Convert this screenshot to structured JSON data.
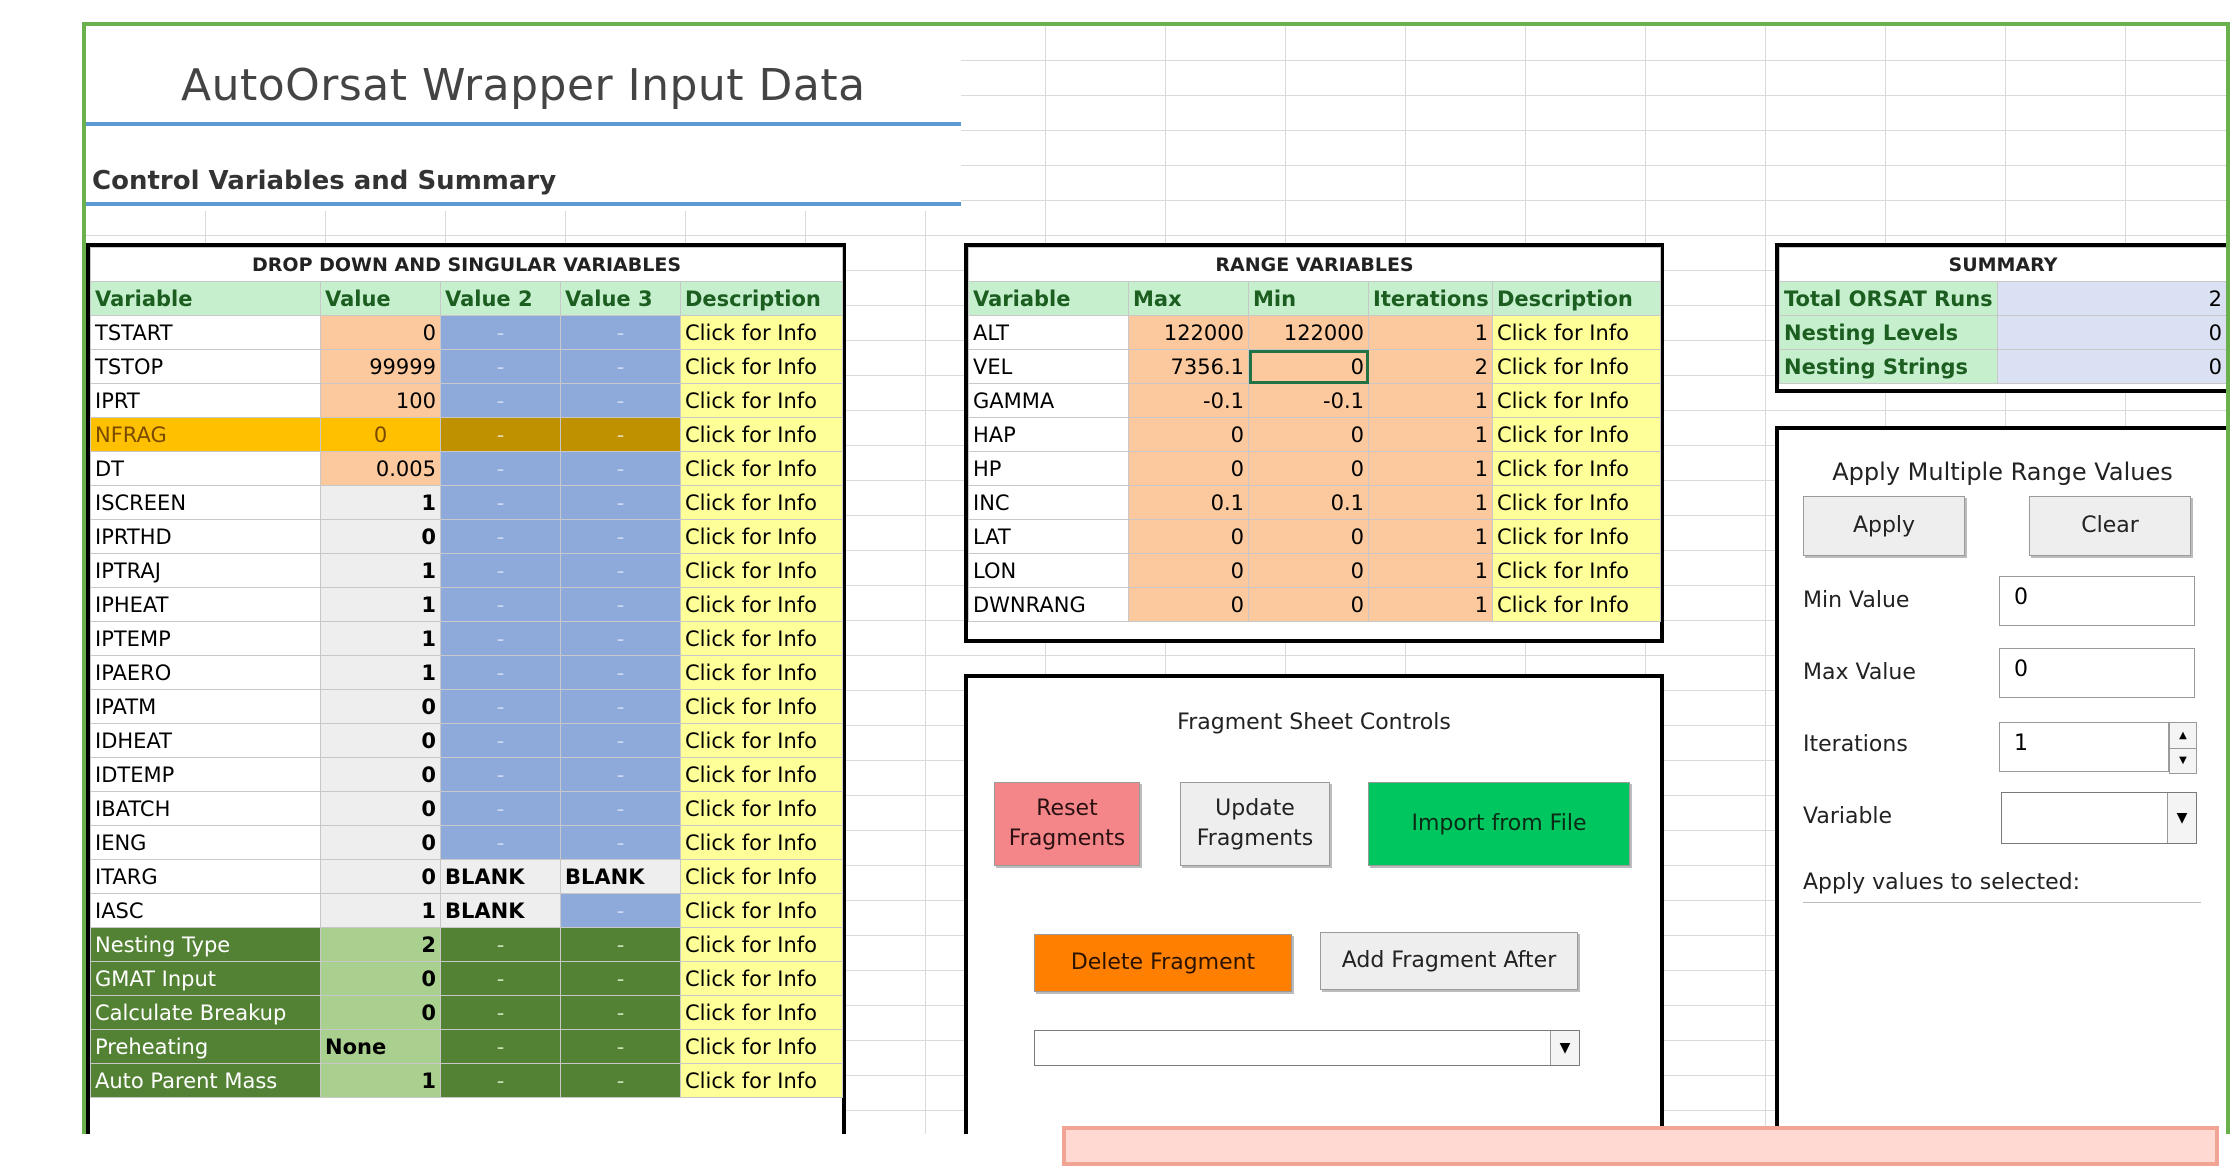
{
  "title": "AutoOrsat Wrapper Input Data",
  "subtitle": "Control Variables and Summary",
  "colors": {
    "frame_border": "#6ab04c",
    "title_rule": "#5b9bd5",
    "header_green": "#c6efce",
    "peach": "#fbc99d",
    "blue": "#8eaadb",
    "info_yellow": "#ffff99",
    "highlight": "#ffc000",
    "dark_green": "#548235",
    "reset_red": "#f4868a",
    "import_green": "#00c660",
    "delete_orange": "#ff7f00"
  },
  "dropdown_table": {
    "title": "DROP DOWN  AND SINGULAR VARIABLES",
    "headers": [
      "Variable",
      "Value",
      "Value 2",
      "Value 3",
      "Description"
    ],
    "rows": [
      {
        "name": "TSTART",
        "value": "0",
        "v2": "-",
        "v3": "-",
        "desc": "Click for Info",
        "style": "peach"
      },
      {
        "name": "TSTOP",
        "value": "99999",
        "v2": "-",
        "v3": "-",
        "desc": "Click for Info",
        "style": "peach"
      },
      {
        "name": "IPRT",
        "value": "100",
        "v2": "-",
        "v3": "-",
        "desc": "Click for Info",
        "style": "peach"
      },
      {
        "name": "NFRAG",
        "value": "0",
        "v2": "-",
        "v3": "-",
        "desc": "Click for Info",
        "style": "highlight"
      },
      {
        "name": "DT",
        "value": "0.005",
        "v2": "-",
        "v3": "-",
        "desc": "Click for Info",
        "style": "peach"
      },
      {
        "name": "ISCREEN",
        "value": "1",
        "v2": "-",
        "v3": "-",
        "desc": "Click for Info",
        "style": "gray"
      },
      {
        "name": "IPRTHD",
        "value": "0",
        "v2": "-",
        "v3": "-",
        "desc": "Click for Info",
        "style": "gray"
      },
      {
        "name": "IPTRAJ",
        "value": "1",
        "v2": "-",
        "v3": "-",
        "desc": "Click for Info",
        "style": "gray"
      },
      {
        "name": "IPHEAT",
        "value": "1",
        "v2": "-",
        "v3": "-",
        "desc": "Click for Info",
        "style": "gray"
      },
      {
        "name": "IPTEMP",
        "value": "1",
        "v2": "-",
        "v3": "-",
        "desc": "Click for Info",
        "style": "gray"
      },
      {
        "name": "IPAERO",
        "value": "1",
        "v2": "-",
        "v3": "-",
        "desc": "Click for Info",
        "style": "gray"
      },
      {
        "name": "IPATM",
        "value": "0",
        "v2": "-",
        "v3": "-",
        "desc": "Click for Info",
        "style": "gray"
      },
      {
        "name": "IDHEAT",
        "value": "0",
        "v2": "-",
        "v3": "-",
        "desc": "Click for Info",
        "style": "gray"
      },
      {
        "name": "IDTEMP",
        "value": "0",
        "v2": "-",
        "v3": "-",
        "desc": "Click for Info",
        "style": "gray"
      },
      {
        "name": "IBATCH",
        "value": "0",
        "v2": "-",
        "v3": "-",
        "desc": "Click for Info",
        "style": "gray"
      },
      {
        "name": "IENG",
        "value": "0",
        "v2": "-",
        "v3": "-",
        "desc": "Click for Info",
        "style": "gray"
      },
      {
        "name": "ITARG",
        "value": "0",
        "v2": "BLANK",
        "v3": "BLANK",
        "desc": "Click for Info",
        "style": "gray"
      },
      {
        "name": "IASC",
        "value": "1",
        "v2": "BLANK",
        "v3": "-",
        "desc": "Click for Info",
        "style": "gray"
      },
      {
        "name": "Nesting Type",
        "value": "2",
        "v2": "-",
        "v3": "-",
        "desc": "Click for Info",
        "style": "green"
      },
      {
        "name": "GMAT Input",
        "value": "0",
        "v2": "-",
        "v3": "-",
        "desc": "Click for Info",
        "style": "green"
      },
      {
        "name": "Calculate Breakup",
        "value": "0",
        "v2": "-",
        "v3": "-",
        "desc": "Click for Info",
        "style": "green"
      },
      {
        "name": "Preheating",
        "value": "None",
        "v2": "-",
        "v3": "-",
        "desc": "Click for Info",
        "style": "green"
      },
      {
        "name": "Auto Parent Mass",
        "value": "1",
        "v2": "-",
        "v3": "-",
        "desc": "Click for Info",
        "style": "green"
      }
    ]
  },
  "range_table": {
    "title": "RANGE VARIABLES",
    "headers": [
      "Variable",
      "Max",
      "Min",
      "Iterations",
      "Description"
    ],
    "rows": [
      {
        "name": "ALT",
        "max": "122000",
        "min": "122000",
        "iter": "1",
        "desc": "Click for Info"
      },
      {
        "name": "VEL",
        "max": "7356.1",
        "min": "0",
        "iter": "2",
        "desc": "Click for Info"
      },
      {
        "name": "GAMMA",
        "max": "-0.1",
        "min": "-0.1",
        "iter": "1",
        "desc": "Click for Info"
      },
      {
        "name": "HAP",
        "max": "0",
        "min": "0",
        "iter": "1",
        "desc": "Click for Info"
      },
      {
        "name": "HP",
        "max": "0",
        "min": "0",
        "iter": "1",
        "desc": "Click for Info"
      },
      {
        "name": "INC",
        "max": "0.1",
        "min": "0.1",
        "iter": "1",
        "desc": "Click for Info"
      },
      {
        "name": "LAT",
        "max": "0",
        "min": "0",
        "iter": "1",
        "desc": "Click for Info"
      },
      {
        "name": "LON",
        "max": "0",
        "min": "0",
        "iter": "1",
        "desc": "Click for Info"
      },
      {
        "name": "DWNRANG",
        "max": "0",
        "min": "0",
        "iter": "1",
        "desc": "Click for Info"
      }
    ]
  },
  "summary": {
    "title": "SUMMARY",
    "rows": [
      {
        "label": "Total ORSAT Runs",
        "value": "2"
      },
      {
        "label": "Nesting Levels",
        "value": "0"
      },
      {
        "label": "Nesting Strings",
        "value": "0"
      }
    ]
  },
  "fragment_controls": {
    "title": "Fragment Sheet Controls",
    "reset_label": "Reset\nFragments",
    "update_label": "Update\nFragments",
    "import_label": "Import from File",
    "delete_label": "Delete Fragment",
    "add_label": "Add Fragment After",
    "fragment_select_value": ""
  },
  "apply_range": {
    "title": "Apply Multiple Range Values",
    "apply_label": "Apply",
    "clear_label": "Clear",
    "min_label": "Min Value",
    "min_value": "0",
    "max_label": "Max Value",
    "max_value": "0",
    "iter_label": "Iterations",
    "iter_value": "1",
    "variable_label": "Variable",
    "variable_value": "",
    "selected_label": "Apply values to selected:"
  }
}
